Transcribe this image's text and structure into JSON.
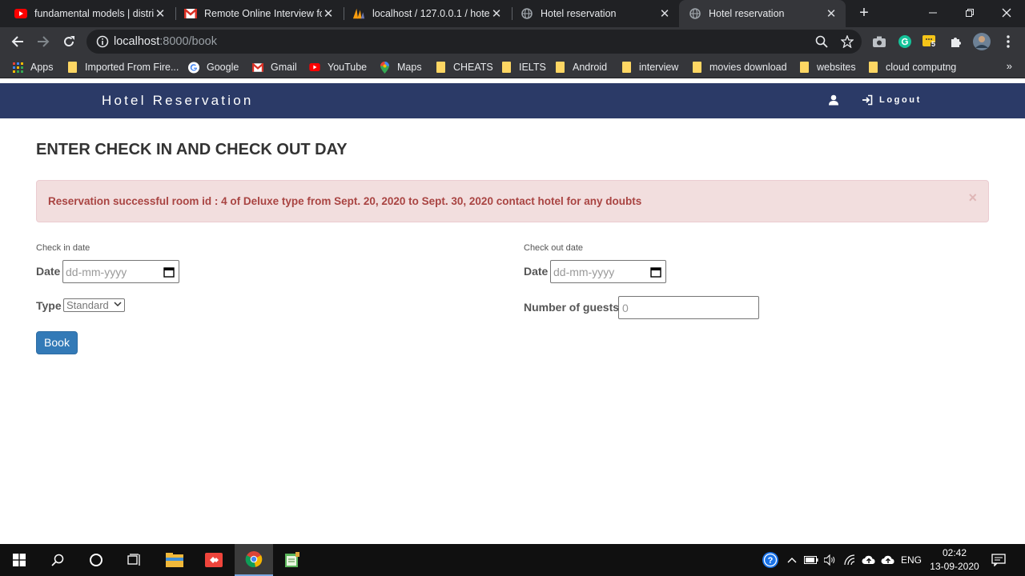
{
  "browser": {
    "tabs": [
      {
        "title": "fundamental models | distri",
        "favicon": "youtube-icon"
      },
      {
        "title": "Remote Online Interview fo",
        "favicon": "gmail-icon"
      },
      {
        "title": "localhost / 127.0.0.1 / hotel",
        "favicon": "phpmyadmin-icon"
      },
      {
        "title": "Hotel reservation",
        "favicon": "globe-icon"
      },
      {
        "title": "Hotel reservation",
        "favicon": "globe-icon"
      }
    ],
    "address": {
      "host": "localhost",
      "path": ":8000/book"
    },
    "extension_badge": "5",
    "bookmarks": [
      {
        "label": "Apps",
        "icon": "apps-grid-icon"
      },
      {
        "label": "Imported From Fire...",
        "icon": "folder-icon"
      },
      {
        "label": "Google",
        "icon": "google-icon"
      },
      {
        "label": "Gmail",
        "icon": "gmail-icon"
      },
      {
        "label": "YouTube",
        "icon": "youtube-icon"
      },
      {
        "label": "Maps",
        "icon": "maps-icon"
      },
      {
        "label": "CHEATS",
        "icon": "folder-icon"
      },
      {
        "label": "IELTS",
        "icon": "folder-icon"
      },
      {
        "label": "Android",
        "icon": "folder-icon"
      },
      {
        "label": "interview",
        "icon": "folder-icon"
      },
      {
        "label": "movies download",
        "icon": "folder-icon"
      },
      {
        "label": "websites",
        "icon": "folder-icon"
      },
      {
        "label": "cloud computng",
        "icon": "folder-icon"
      }
    ],
    "bookmarks_more": "»"
  },
  "site": {
    "brand": "Hotel Reservation",
    "logout_label": "Logout",
    "page_title": "ENTER CHECK IN AND CHECK OUT DAY",
    "alert": {
      "message": "Reservation successful room id : 4 of Deluxe type from Sept. 20, 2020 to Sept. 30, 2020 contact hotel for any doubts",
      "close": "×"
    },
    "form": {
      "checkin_heading": "Check in date",
      "checkout_heading": "Check out date",
      "date_label": "Date",
      "date_placeholder": "dd-mm-yyyy",
      "type_label": "Type",
      "type_selected": "Standard",
      "guests_label": "Number of guests",
      "guests_placeholder": "0",
      "book_label": "Book"
    }
  },
  "taskbar": {
    "language": "ENG",
    "time": "02:42",
    "date": "13-09-2020"
  },
  "colors": {
    "navbar": "#2b3a67",
    "alert_bg": "#f2dede",
    "alert_text": "#a94442",
    "button": "#337ab7"
  }
}
